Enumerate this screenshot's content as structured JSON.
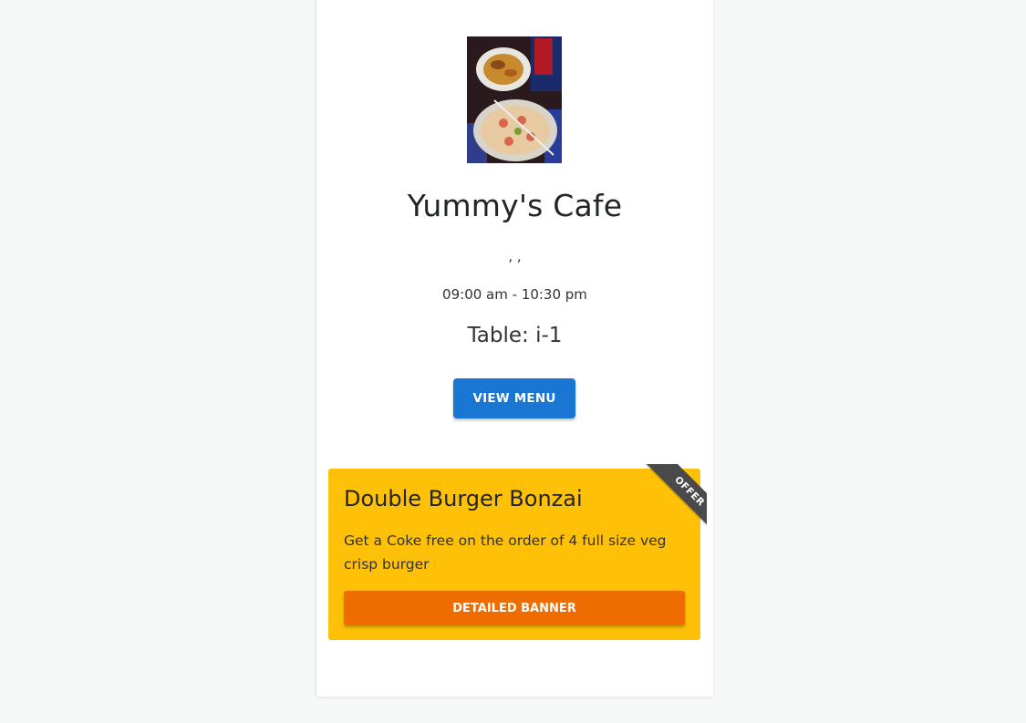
{
  "cafe": {
    "name": "Yummy's Cafe",
    "address": ", ,",
    "hours": "09:00 am - 10:30 pm",
    "table": "Table: i-1",
    "view_menu_label": "VIEW MENU"
  },
  "offer": {
    "ribbon": "OFFER",
    "title": "Double Burger Bonzai",
    "description": "Get a Coke free on the order of 4 full size veg crisp burger",
    "button_label": "DETAILED BANNER"
  },
  "colors": {
    "primary": "#1976d2",
    "offer_bg": "#ffc107",
    "offer_button": "#ef6c00",
    "ribbon": "#4a4a4a"
  }
}
